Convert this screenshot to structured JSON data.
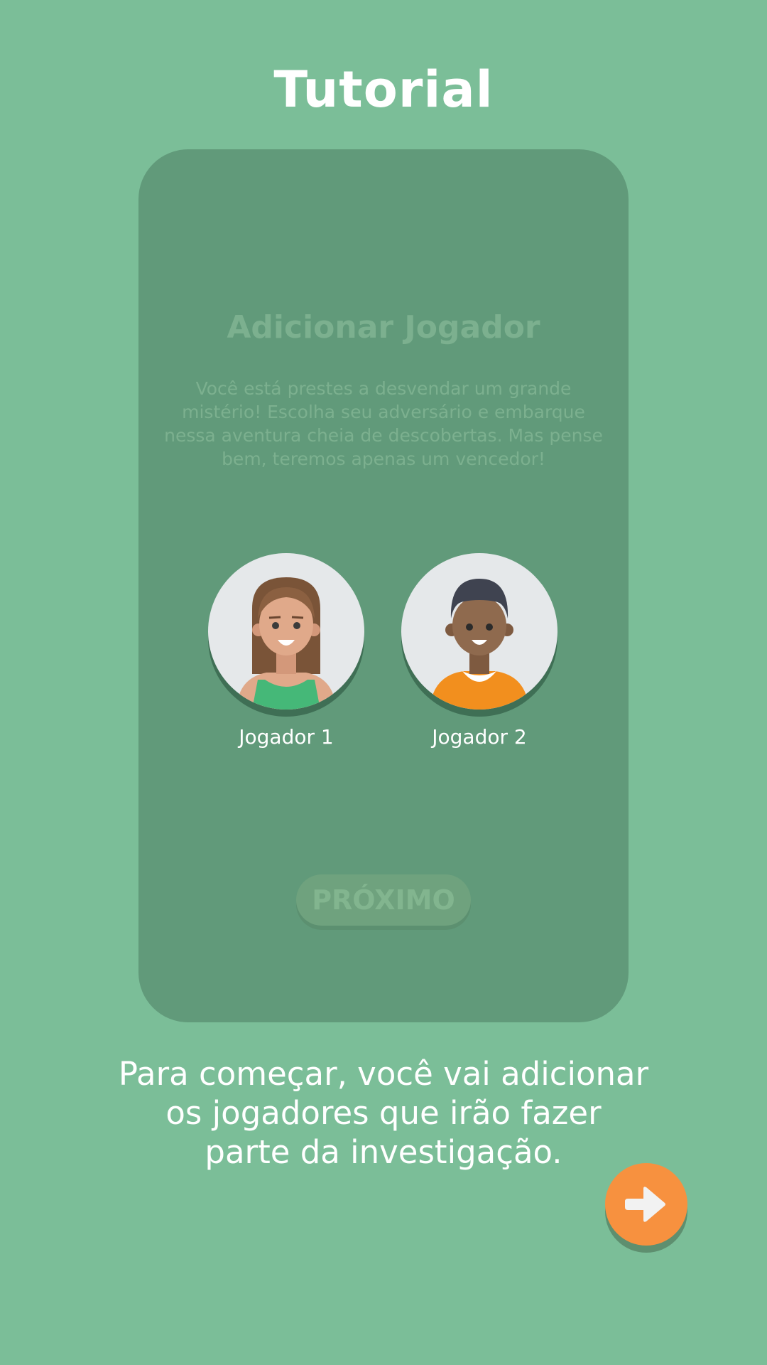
{
  "header": {
    "title": "Tutorial"
  },
  "card": {
    "heading": "Adicionar Jogador",
    "description": "Você está prestes a desvendar um grande mistério! Escolha seu adversário e embarque nessa aventura cheia de descobertas. Mas pense bem, teremos apenas um vencedor!",
    "players": [
      {
        "label": "Jogador 1",
        "avatar": "female-avatar-icon"
      },
      {
        "label": "Jogador 2",
        "avatar": "male-avatar-icon"
      }
    ],
    "next_label": "PRÓXIMO"
  },
  "instruction": {
    "line1": "Para começar,  você vai adicionar",
    "line2": "os jogadores que irão fazer",
    "line3": "parte da investigação."
  },
  "next_button": {
    "icon": "arrow-right-icon"
  },
  "colors": {
    "background": "#7bbe98",
    "card": "#619a7a",
    "accent": "#f7913f"
  }
}
